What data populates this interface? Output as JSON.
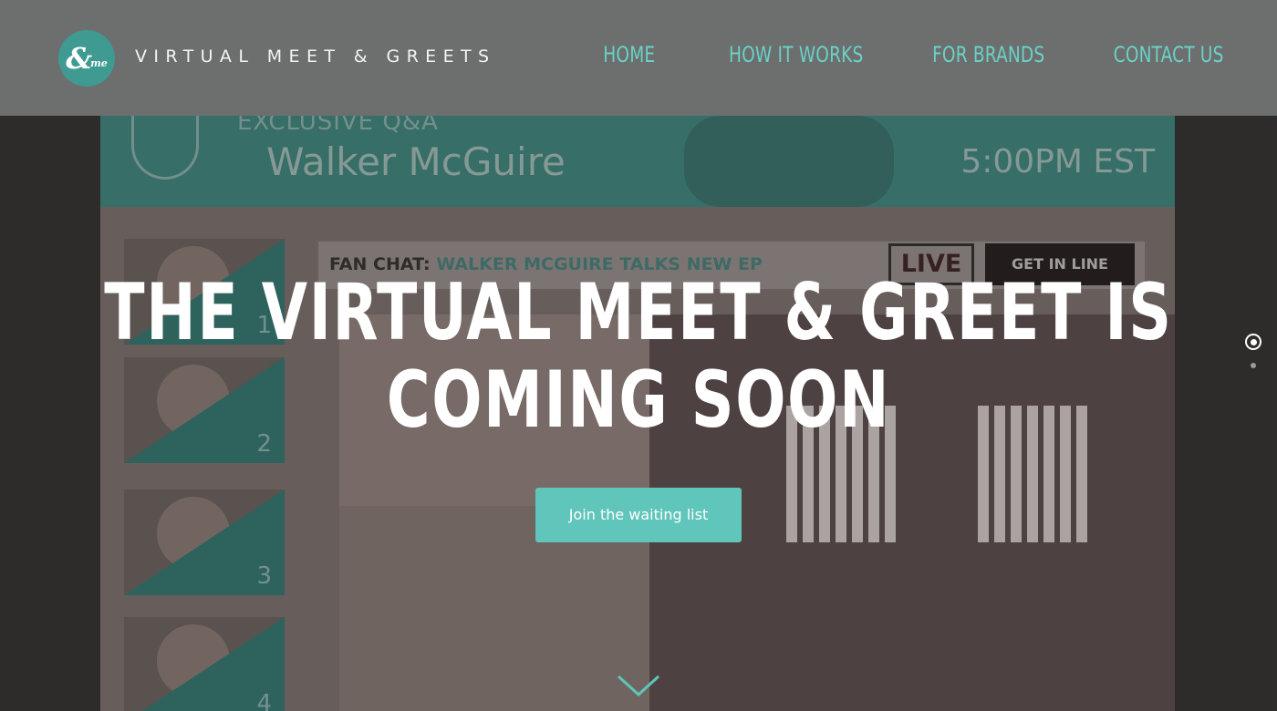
{
  "header": {
    "logo_text": "&me",
    "brand_title": "VIRTUAL MEET & GREETS",
    "nav": [
      {
        "label": "HOME"
      },
      {
        "label": "HOW IT WORKS"
      },
      {
        "label": "FOR BRANDS"
      },
      {
        "label": "CONTACT US"
      }
    ]
  },
  "background_screen": {
    "banner_subtitle": "EXCLUSIVE Q&A",
    "banner_name": "Walker McGuire",
    "banner_time": "5:00PM EST",
    "chat_prefix": "FAN CHAT:",
    "chat_topic": "WALKER MCGUIRE TALKS NEW EP",
    "live_badge": "LIVE",
    "get_in_line": "GET IN LINE",
    "thumbnails": [
      {
        "number": "1"
      },
      {
        "number": "2"
      },
      {
        "number": "3"
      },
      {
        "number": "4"
      }
    ]
  },
  "hero": {
    "headline_line1": "THE VIRTUAL MEET & GREET IS",
    "headline_line2": "COMING SOON",
    "cta_label": "Join the waiting list"
  },
  "icons": {
    "scroll": "chevron-down-icon",
    "pager": "pager-dot-icon"
  },
  "colors": {
    "header_bg": "#6d6e6e",
    "accent_teal": "#69d2c7",
    "cta_bg": "#60c5bb",
    "logo_bg": "#3f9a91"
  }
}
